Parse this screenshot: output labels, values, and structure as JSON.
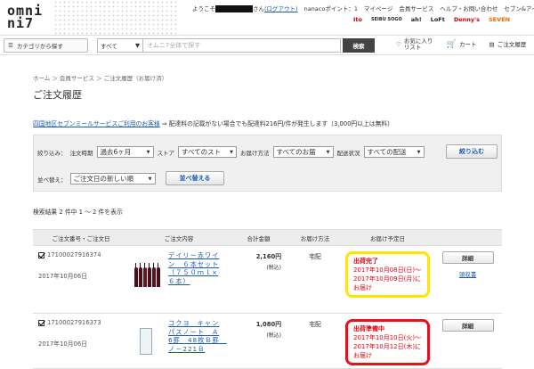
{
  "header": {
    "logo_line1": "omni",
    "logo_line2": "ni7",
    "greeting_prefix": "ようこそ",
    "greeting_suffix": "さん",
    "logout": "(ログアウト)",
    "nanaco": "nanacoポイント：",
    "nanaco_points": "1",
    "mypage": "マイページ",
    "member": "会員サービス",
    "help": "ヘルプ・お問い合わせ",
    "seven_i": "セブン&アイのトップ",
    "brands": [
      "Ito",
      "SEIBU SOGO",
      "ah!",
      "LoFt",
      "Denny's",
      "SEVEN"
    ]
  },
  "search": {
    "category_btn": "カテゴリから探す",
    "scope": "すべて",
    "placeholder": "オムニ7全体で探す",
    "button": "検索",
    "fav": "お気に入りリスト",
    "cart": "カート",
    "receipt_method": "ご注文履歴"
  },
  "breadcrumb": "ホーム ＞ 会員サービス ＞ ご注文履歴（お届け済）",
  "page_title": "ご注文履歴",
  "notice": {
    "link": "四国地区セブンミールサービスご利用のお客様",
    "text": "⇒ 配達料の記載がない場合でも配達料216円/件が発生します（3,000円以上は無料）"
  },
  "filter": {
    "narrow": "絞り込み：",
    "period_label": "注文時期",
    "period_value": "過去6ヶ月",
    "store_label": "ストア",
    "store_value": "すべてのスト",
    "method_label": "お届け方法",
    "method_value": "すべてのお届",
    "status_label": "配送状況",
    "status_value": "すべての配送",
    "apply": "絞り込む",
    "sort_label": "並べ替え：",
    "sort_value": "ご注文日の新しい順",
    "sort_btn": "並べ替える"
  },
  "result": "検索結果 2 件中 1 〜 2 件を表示",
  "columns": [
    "ご注文番号・ご注文日",
    "ご注文内容",
    "合計金額",
    "お届け方法",
    "お届け予定日",
    ""
  ],
  "orders": [
    {
      "id": "17100027916374",
      "date": "2017年10月06日",
      "product": "デイリー赤ワイン　６本セット（７５０ｍｌ×６本）",
      "price": "2,160円",
      "tax": "(税込)",
      "method": "宅配",
      "status_label": "出荷完了",
      "status_dates": "2017年10月08日(日)〜2017年10月09日(月)にお届け",
      "detail": "詳細",
      "receipt": "領収書"
    },
    {
      "id": "17100027916373",
      "date": "2017年10月06日",
      "product": "コクヨ　キャンパスノート　Ａ6罫　48枚Ｂ罫　ノ－221Ｂ",
      "price": "1,080円",
      "tax": "(税込)",
      "method": "宅配",
      "status_label": "出荷準備中",
      "status_dates": "2017年10月10日(火)〜2017年10月12日(木)にお届け",
      "detail": "詳細"
    }
  ]
}
